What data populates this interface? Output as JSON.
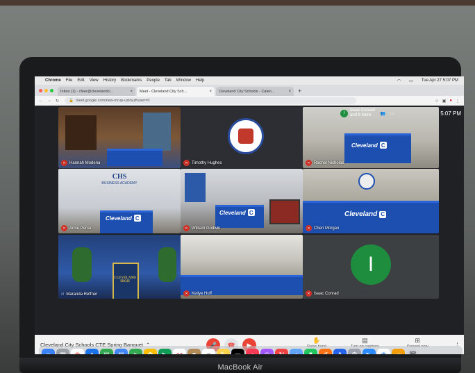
{
  "device": {
    "brand": "MacBook Air"
  },
  "menubar": {
    "items": [
      "Chrome",
      "File",
      "Edit",
      "View",
      "History",
      "Bookmarks",
      "People",
      "Tab",
      "Window",
      "Help"
    ],
    "datetime": "Tue Apr 27 5:07 PM"
  },
  "browser": {
    "tabs": [
      {
        "label": "Inbox (1) - cfeer@clevelandci..."
      },
      {
        "label": "Meet - Cleveland City Sch..."
      },
      {
        "label": "Cleveland City Schools - Calen..."
      }
    ],
    "url": "meet.google.com/new-mrup-uzt/authuser=0"
  },
  "meet": {
    "top_right": {
      "participants_text": "Isaac Conrad\nand 8 more",
      "clock": "5:07 PM",
      "avatar_initial": "I"
    },
    "tiles": [
      {
        "name": "Hannah Modena"
      },
      {
        "name": "Timothy Hughes",
        "logo_text": "HIGH SPIDER CORPS · CLEVELAND HIGH"
      },
      {
        "name": "Rachel Nicholas",
        "banner": "Cleveland"
      },
      {
        "name": "Anne Perso",
        "header": "CHS",
        "subheader": "BUSINESS ACADEMY",
        "banner": "Cleveland"
      },
      {
        "name": "William Godwin",
        "banner": "Cleveland"
      },
      {
        "name": "Cheri Morgan",
        "banner": "Cleveland"
      },
      {
        "name": "Maranda Reffner",
        "podium": "CLEVELAND HIGH"
      },
      {
        "name": "Kellye Huff"
      },
      {
        "name": "Isaac Conrad",
        "avatar_initial": "I"
      }
    ],
    "controls": {
      "meeting_name": "Cleveland City Schools CTE Spring Banquet",
      "raise_hand": "Raise hand",
      "captions": "Turn on captions",
      "present": "Present now"
    }
  },
  "colors": {
    "meet_bg": "#202124",
    "red": "#ea4335",
    "green": "#1e8e3e",
    "banner_blue": "#1d4fb0"
  }
}
